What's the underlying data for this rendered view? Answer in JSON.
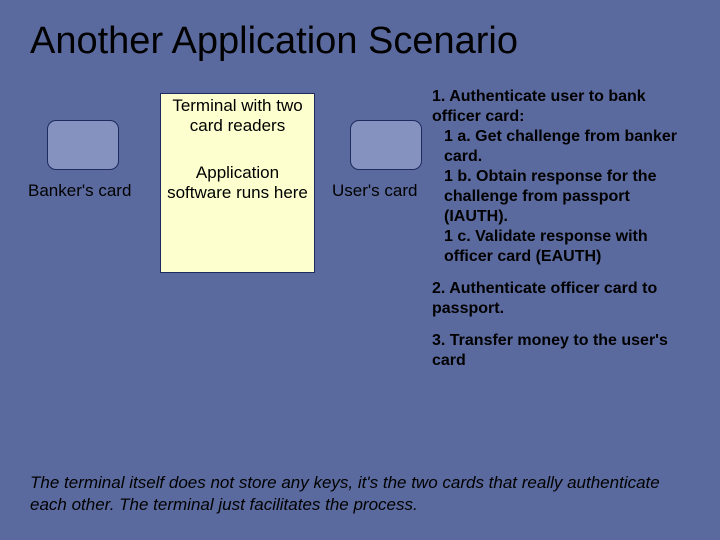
{
  "title": "Another Application Scenario",
  "terminal": {
    "top": "Terminal with two card readers",
    "bottom": "Application software runs here"
  },
  "labels": {
    "banker": "Banker's card",
    "user": "User's card"
  },
  "steps": {
    "s1": "1. Authenticate user to bank officer card:",
    "s1a": "1 a. Get challenge from banker card.",
    "s1b": "1 b. Obtain response for the challenge from passport (IAUTH).",
    "s1c": "1 c. Validate response with officer card (EAUTH)",
    "s2": "2. Authenticate officer card to passport.",
    "s3": "3. Transfer money to the user's card"
  },
  "footer": "The terminal itself does not store any keys, it's the two cards that really authenticate each other.  The terminal just facilitates the process."
}
